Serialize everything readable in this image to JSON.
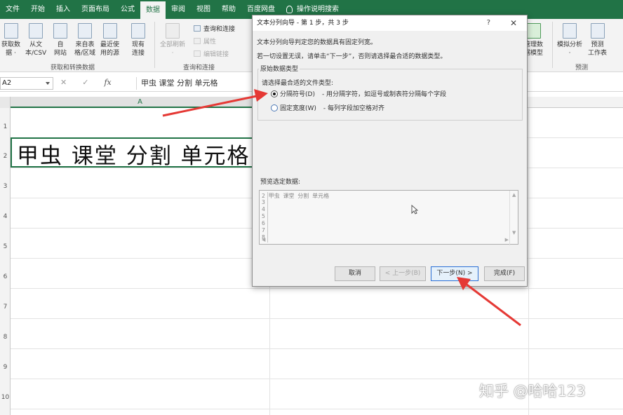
{
  "tabs": [
    {
      "label": "文件",
      "active": false
    },
    {
      "label": "开始",
      "active": false
    },
    {
      "label": "插入",
      "active": false
    },
    {
      "label": "页面布局",
      "active": false
    },
    {
      "label": "公式",
      "active": false
    },
    {
      "label": "数据",
      "active": true
    },
    {
      "label": "审阅",
      "active": false
    },
    {
      "label": "视图",
      "active": false
    },
    {
      "label": "帮助",
      "active": false
    },
    {
      "label": "百度网盘",
      "active": false
    }
  ],
  "tell_me": "操作说明搜索",
  "ribbon": {
    "get_data": {
      "line1": "获取数",
      "line2": "据 ·"
    },
    "from_csv": {
      "line1": "从文",
      "line2": "本/CSV"
    },
    "from_web": {
      "line1": "自",
      "line2": "网站"
    },
    "from_table": {
      "line1": "来自表",
      "line2": "格/区域"
    },
    "recent_sources": {
      "line1": "最近使",
      "line2": "用的源"
    },
    "existing_conn": {
      "line1": "现有",
      "line2": "连接"
    },
    "group_get_transform": "获取和转换数据",
    "refresh_all": {
      "line1": "全部刷新",
      "line2": "·"
    },
    "queries_connections": "查询和连接",
    "properties": "属性",
    "edit_links": "编辑链接",
    "group_queries": "查询和连接",
    "manage_model": {
      "line1": "管理数",
      "line2": "据模型"
    },
    "what_if": {
      "line1": "模拟分析",
      "line2": "·"
    },
    "forecast_sheet": {
      "line1": "预测",
      "line2": "工作表"
    },
    "group_forecast": "预测"
  },
  "formula_bar": {
    "name_box": "A2",
    "cancel_symbol": "✕",
    "enter_symbol": "✓",
    "fx": "fx",
    "content": "甲虫 课堂 分割 单元格"
  },
  "grid": {
    "column_A": "A",
    "rows": [
      "1",
      "2",
      "3",
      "4",
      "5",
      "6",
      "7",
      "8",
      "9",
      "10"
    ],
    "cell_A2": "甲虫 课堂 分割 单元格"
  },
  "dialog": {
    "title": "文本分列向导 - 第 1 步，共 3 步",
    "help": "?",
    "close": "✕",
    "intro1": "文本分列向导判定您的数据具有固定列宽。",
    "intro2": "若一切设置无误，请单击“下一步”，否则请选择最合适的数据类型。",
    "group_label": "原始数据类型",
    "prompt": "请选择最合适的文件类型:",
    "delimited_label": "分隔符号(D)",
    "delimited_desc": "- 用分隔字符，如逗号或制表符分隔每个字段",
    "fixed_label": "固定宽度(W)",
    "fixed_desc": "- 每列字段加空格对齐",
    "selected_type": "delimited",
    "preview_label": "预览选定数据:",
    "preview_rows": [
      {
        "n": "2",
        "text": "甲虫 课堂 分割 单元格"
      },
      {
        "n": "3",
        "text": ""
      },
      {
        "n": "4",
        "text": ""
      },
      {
        "n": "5",
        "text": ""
      },
      {
        "n": "6",
        "text": ""
      },
      {
        "n": "7",
        "text": ""
      },
      {
        "n": "8",
        "text": ""
      }
    ],
    "buttons": {
      "cancel": "取消",
      "back": "< 上一步(B)",
      "next": "下一步(N) >",
      "finish": "完成(F)"
    }
  },
  "colors": {
    "excel_green": "#217346",
    "annotation_red": "#e53935",
    "focus_blue": "#2b6fd6"
  },
  "watermark": "知乎 @哈哈123"
}
